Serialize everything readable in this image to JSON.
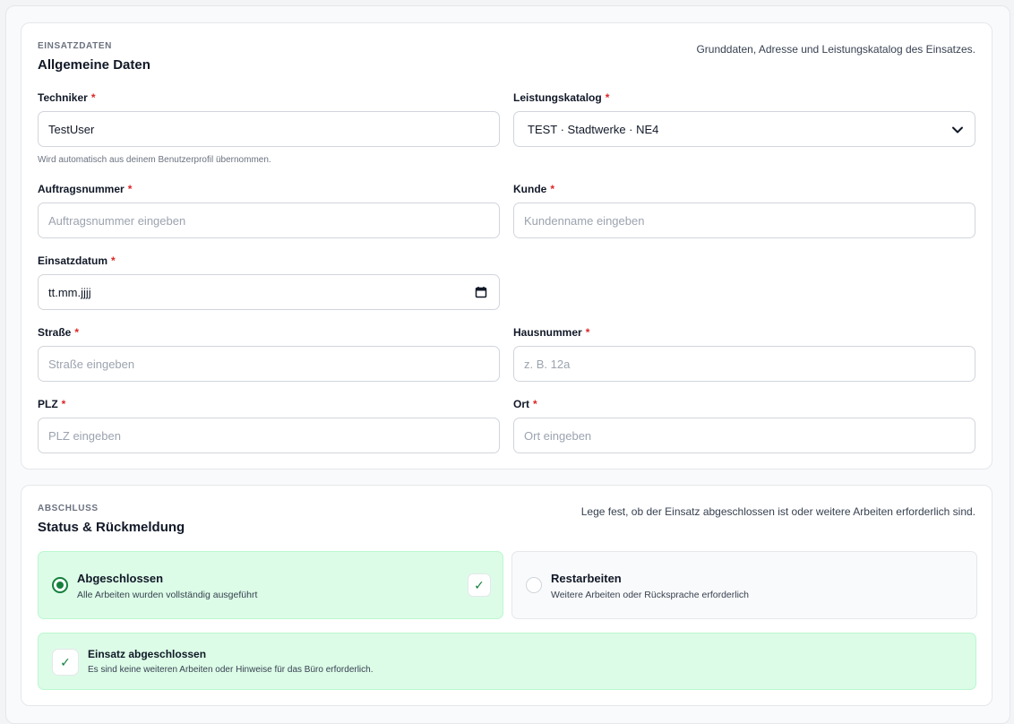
{
  "section1": {
    "eyebrow": "EINSATZDATEN",
    "title": "Allgemeine Daten",
    "description": "Grunddaten, Adresse und Leistungskatalog des Einsatzes.",
    "required_marker": "*",
    "technician": {
      "label": "Techniker",
      "value": "TestUser",
      "hint": "Wird automatisch aus deinem Benutzerprofil übernommen."
    },
    "catalog": {
      "label": "Leistungskatalog",
      "selected": "TEST · Stadtwerke · NE4"
    },
    "order_number": {
      "label": "Auftragsnummer",
      "placeholder": "Auftragsnummer eingeben"
    },
    "customer": {
      "label": "Kunde",
      "placeholder": "Kundenname eingeben"
    },
    "date": {
      "label": "Einsatzdatum",
      "placeholder": "tt.mm.jjjj"
    },
    "street": {
      "label": "Straße",
      "placeholder": "Straße eingeben"
    },
    "house_number": {
      "label": "Hausnummer",
      "placeholder": "z. B. 12a"
    },
    "zip": {
      "label": "PLZ",
      "placeholder": "PLZ eingeben"
    },
    "city": {
      "label": "Ort",
      "placeholder": "Ort eingeben"
    }
  },
  "section2": {
    "eyebrow": "ABSCHLUSS",
    "title": "Status & Rückmeldung",
    "description": "Lege fest, ob der Einsatz abgeschlossen ist oder weitere Arbeiten erforderlich sind.",
    "options": [
      {
        "title": "Abgeschlossen",
        "subtitle": "Alle Arbeiten wurden vollständig ausgeführt",
        "selected": true
      },
      {
        "title": "Restarbeiten",
        "subtitle": "Weitere Arbeiten oder Rücksprache erforderlich",
        "selected": false
      }
    ],
    "check_glyph": "✓",
    "banner": {
      "title": "Einsatz abgeschlossen",
      "subtitle": "Es sind keine weiteren Arbeiten oder Hinweise für das Büro erforderlich."
    }
  },
  "colors": {
    "accent_green": "#15803d",
    "success_bg": "#dcfce7",
    "required_red": "#dc2626"
  },
  "icons": {
    "catalog_dropdown": "chevron-down-icon",
    "date_picker": "calendar-icon",
    "selected_check": "check-icon"
  }
}
